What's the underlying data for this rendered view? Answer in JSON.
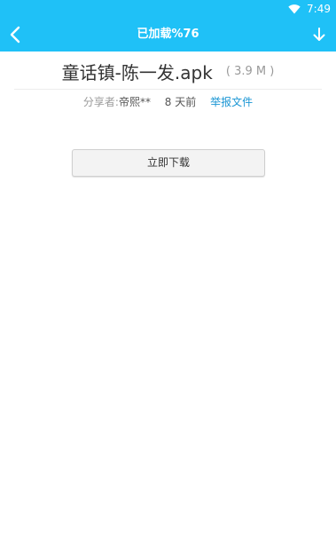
{
  "status_bar": {
    "time": "7:49",
    "icon": "wifi-icon",
    "background": "#1fc1f7"
  },
  "app_bar": {
    "title": "已加载%76",
    "back_icon": "chevron-left-icon",
    "download_icon": "arrow-down-icon",
    "background": "#1fc1f7"
  },
  "file": {
    "name": "童话镇-陈一发.apk",
    "size": "( 3.9 M )",
    "sharer_label": "分享者:",
    "sharer_name": "帝熙**",
    "time_ago": "8 天前",
    "report_label": "举报文件",
    "link_color": "#1a96d4"
  },
  "actions": {
    "download_label": "立即下载"
  }
}
